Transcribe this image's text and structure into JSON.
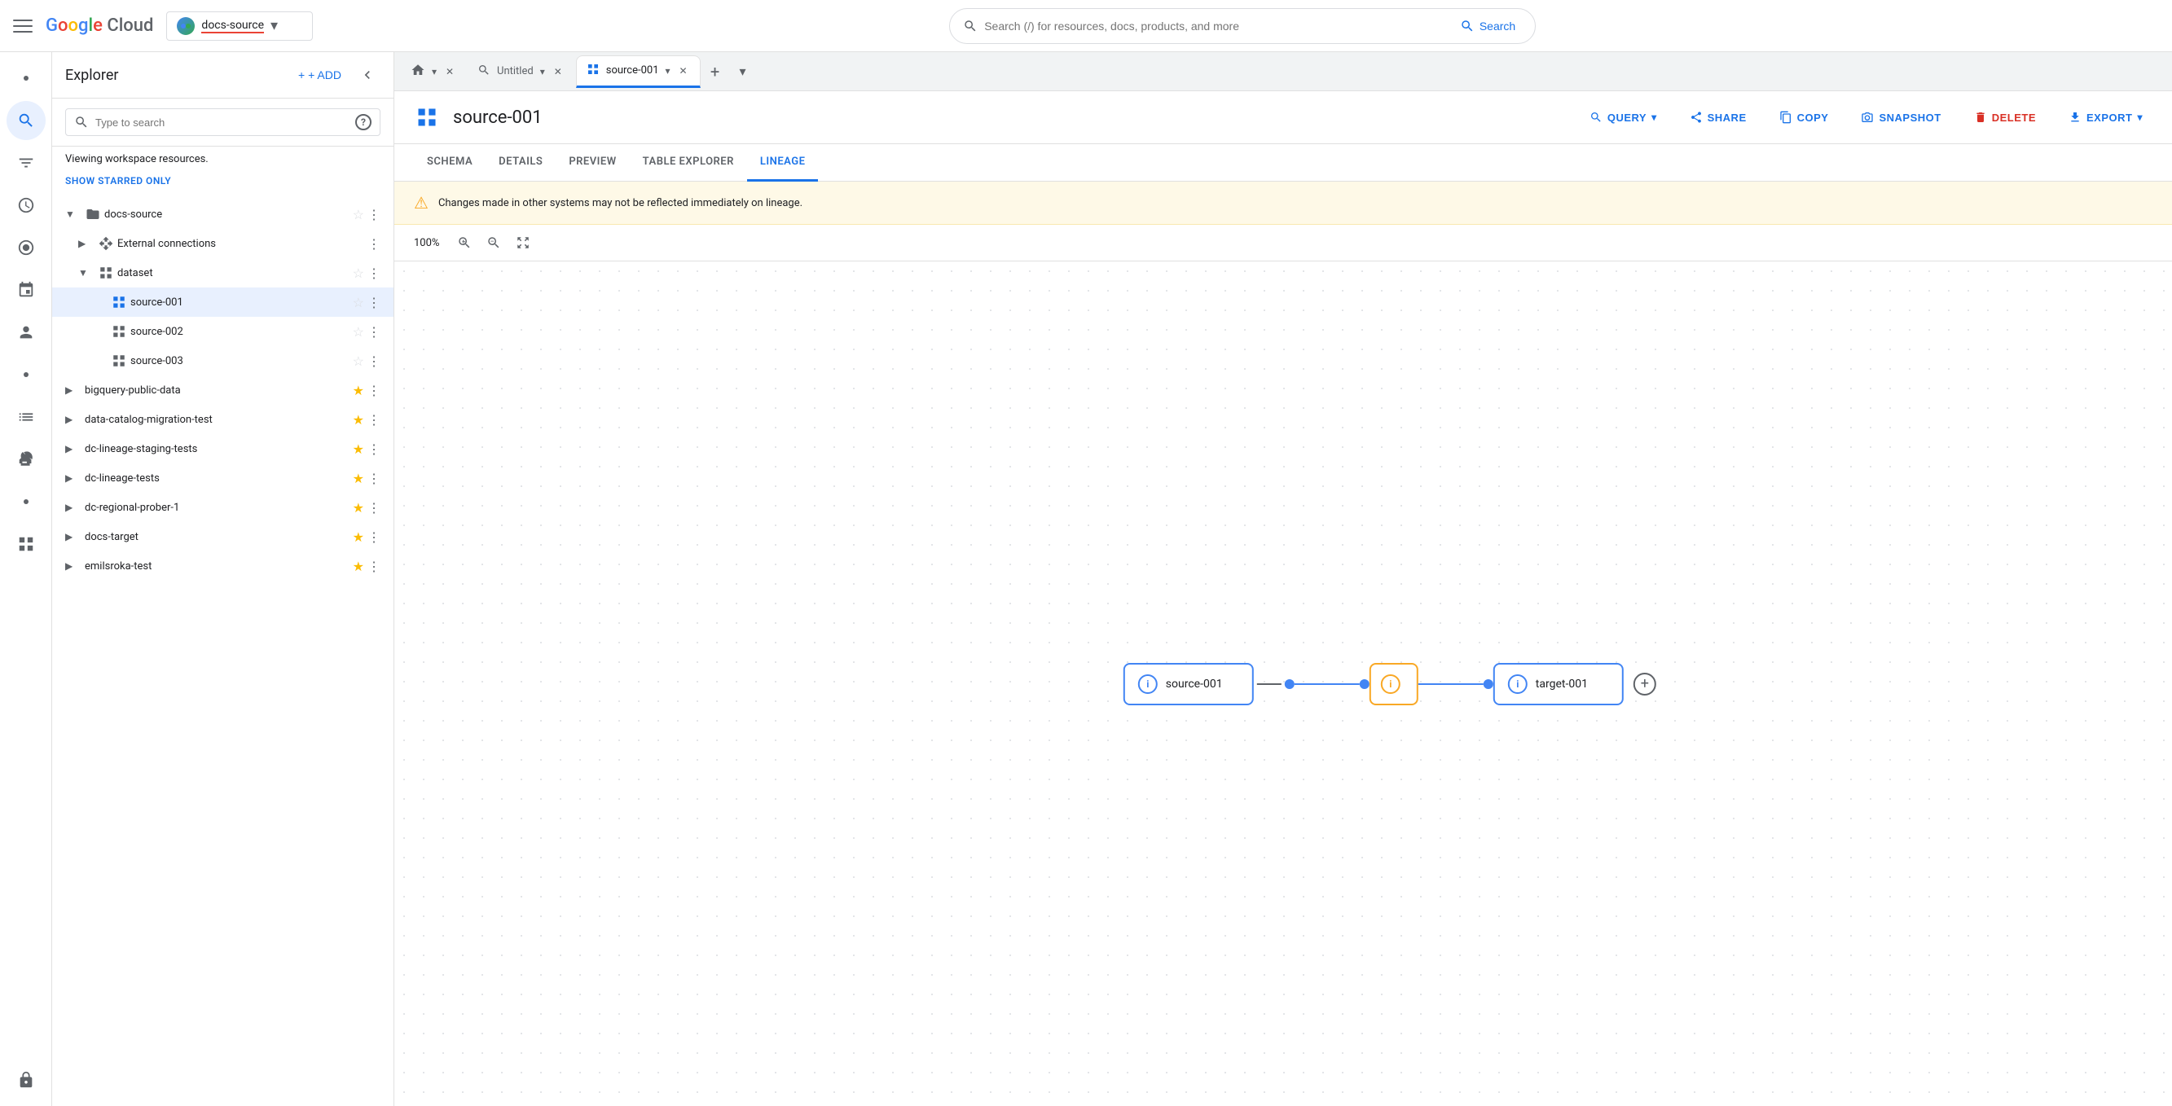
{
  "topbar": {
    "hamburger_label": "menu",
    "logo": {
      "g": "G",
      "o1": "o",
      "o2": "o",
      "g2": "g",
      "l": "l",
      "e": "e",
      "cloud": " Cloud"
    },
    "project": {
      "name": "docs-source",
      "icon_label": "DS"
    },
    "search": {
      "placeholder": "Search (/) for resources, docs, products, and more",
      "button_label": "Search"
    }
  },
  "rail": {
    "icons": [
      {
        "name": "dot-icon",
        "symbol": "●",
        "active": false
      },
      {
        "name": "search-rail-icon",
        "symbol": "⊙",
        "active": true
      },
      {
        "name": "filter-icon",
        "symbol": "⇌",
        "active": false
      },
      {
        "name": "clock-icon",
        "symbol": "◷",
        "active": false
      },
      {
        "name": "star-rail-icon",
        "symbol": "✶",
        "active": false
      },
      {
        "name": "pin-icon",
        "symbol": "✦",
        "active": false
      },
      {
        "name": "person-icon",
        "symbol": "⚇",
        "active": false
      },
      {
        "name": "dot2-icon",
        "symbol": "●",
        "active": false
      },
      {
        "name": "list-icon",
        "symbol": "☰",
        "active": false
      },
      {
        "name": "wrench-icon",
        "symbol": "🔧",
        "active": false
      },
      {
        "name": "dot3-icon",
        "symbol": "●",
        "active": false
      },
      {
        "name": "grid-icon",
        "symbol": "⊞",
        "active": false
      },
      {
        "name": "lock-icon",
        "symbol": "🔒",
        "active": false
      }
    ]
  },
  "explorer": {
    "title": "Explorer",
    "add_label": "+ ADD",
    "search_placeholder": "Type to search",
    "help_tooltip": "?",
    "workspace_label": "Viewing workspace resources.",
    "show_starred_label": "SHOW STARRED ONLY",
    "tree": {
      "items": [
        {
          "id": "docs-source",
          "label": "docs-source",
          "indent": 0,
          "expanded": true,
          "icon": "▼",
          "item_icon": "⬦",
          "starred": false,
          "has_more": true
        },
        {
          "id": "external-connections",
          "label": "External connections",
          "indent": 1,
          "expanded": false,
          "icon": "▶",
          "item_icon": "⇌",
          "starred": false,
          "has_more": true
        },
        {
          "id": "dataset",
          "label": "dataset",
          "indent": 1,
          "expanded": true,
          "icon": "▼",
          "item_icon": "⊞",
          "starred": false,
          "has_more": true
        },
        {
          "id": "source-001",
          "label": "source-001",
          "indent": 2,
          "expanded": false,
          "icon": "",
          "item_icon": "⊞",
          "starred": false,
          "selected": true,
          "has_more": true
        },
        {
          "id": "source-002",
          "label": "source-002",
          "indent": 2,
          "expanded": false,
          "icon": "",
          "item_icon": "⊞",
          "starred": false,
          "has_more": true
        },
        {
          "id": "source-003",
          "label": "source-003",
          "indent": 2,
          "expanded": false,
          "icon": "",
          "item_icon": "⊞",
          "starred": false,
          "has_more": true
        },
        {
          "id": "bigquery-public-data",
          "label": "bigquery-public-data",
          "indent": 0,
          "expanded": false,
          "icon": "▶",
          "starred": true,
          "has_more": true
        },
        {
          "id": "data-catalog-migration-test",
          "label": "data-catalog-migration-test",
          "indent": 0,
          "expanded": false,
          "icon": "▶",
          "starred": true,
          "has_more": true
        },
        {
          "id": "dc-lineage-staging-tests",
          "label": "dc-lineage-staging-tests",
          "indent": 0,
          "expanded": false,
          "icon": "▶",
          "starred": true,
          "has_more": true
        },
        {
          "id": "dc-lineage-tests",
          "label": "dc-lineage-tests",
          "indent": 0,
          "expanded": false,
          "icon": "▶",
          "starred": true,
          "has_more": true
        },
        {
          "id": "dc-regional-prober-1",
          "label": "dc-regional-prober-1",
          "indent": 0,
          "expanded": false,
          "icon": "▶",
          "starred": true,
          "has_more": true
        },
        {
          "id": "docs-target",
          "label": "docs-target",
          "indent": 0,
          "expanded": false,
          "icon": "▶",
          "starred": true,
          "has_more": true
        },
        {
          "id": "emilsroka-test",
          "label": "emilsroka-test",
          "indent": 0,
          "expanded": false,
          "icon": "▶",
          "starred": true,
          "has_more": true
        }
      ]
    }
  },
  "tabs": {
    "items": [
      {
        "id": "home",
        "label": "",
        "icon": "⌂",
        "type": "home",
        "closeable": false,
        "active": false
      },
      {
        "id": "untitled",
        "label": "Untitled",
        "icon": "⊙",
        "type": "query",
        "closeable": true,
        "active": false
      },
      {
        "id": "source-001-tab",
        "label": "source-001",
        "icon": "⊞",
        "type": "table",
        "closeable": true,
        "active": true
      }
    ],
    "add_label": "+",
    "more_label": "▾"
  },
  "table_view": {
    "icon": "⊞",
    "title": "source-001",
    "actions": [
      {
        "id": "query",
        "label": "QUERY",
        "icon": "🔍",
        "has_dropdown": true
      },
      {
        "id": "share",
        "label": "SHARE",
        "icon": "👥"
      },
      {
        "id": "copy",
        "label": "COPY",
        "icon": "⧉"
      },
      {
        "id": "snapshot",
        "label": "SNAPSHOT",
        "icon": "📷"
      },
      {
        "id": "delete",
        "label": "DELETE",
        "icon": "🗑",
        "red": true
      },
      {
        "id": "export",
        "label": "EXPORT",
        "icon": "⬆",
        "has_dropdown": true
      }
    ],
    "sub_tabs": [
      {
        "id": "schema",
        "label": "SCHEMA",
        "active": false
      },
      {
        "id": "details",
        "label": "DETAILS",
        "active": false
      },
      {
        "id": "preview",
        "label": "PREVIEW",
        "active": false
      },
      {
        "id": "table-explorer",
        "label": "TABLE EXPLORER",
        "active": false
      },
      {
        "id": "lineage",
        "label": "LINEAGE",
        "active": true
      }
    ],
    "warning": {
      "icon": "⚠",
      "text": "Changes made in other systems may not be reflected immediately on lineage."
    },
    "zoom": {
      "level": "100%",
      "zoom_in": "+",
      "zoom_out": "−",
      "fit": "⊡"
    },
    "lineage": {
      "nodes": [
        {
          "id": "source-001-node",
          "label": "source-001",
          "icon_type": "blue",
          "icon_symbol": "i"
        },
        {
          "id": "middle-node",
          "label": "",
          "icon_type": "orange",
          "icon_symbol": "i"
        },
        {
          "id": "target-001-node",
          "label": "target-001",
          "icon_type": "blue",
          "icon_symbol": "i"
        }
      ]
    }
  }
}
